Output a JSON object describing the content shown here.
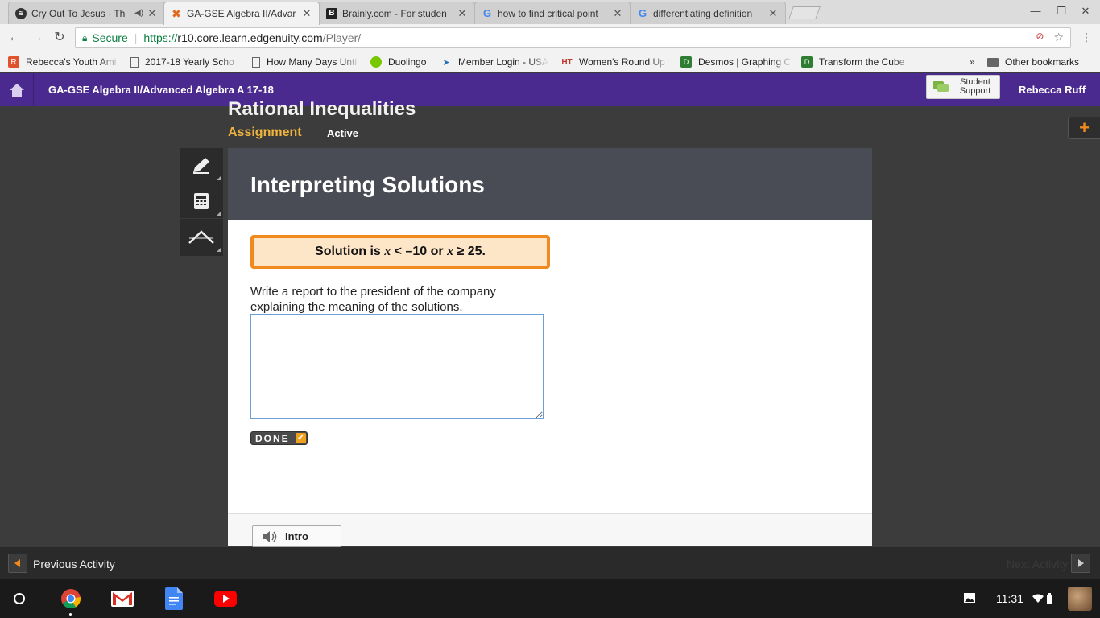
{
  "browser": {
    "tabs": [
      {
        "title": "Cry Out To Jesus · Th",
        "favicon": "spotify-icon",
        "audio": true,
        "active": false
      },
      {
        "title": "GA-GSE Algebra II/Advar",
        "favicon": "edgenuity-icon",
        "audio": false,
        "active": true
      },
      {
        "title": "Brainly.com - For studen",
        "favicon": "brainly-icon",
        "audio": false,
        "active": false
      },
      {
        "title": "how to find critical point",
        "favicon": "google-icon",
        "audio": false,
        "active": false
      },
      {
        "title": "differentiating definition",
        "favicon": "google-icon",
        "audio": false,
        "active": false
      }
    ],
    "omnibox": {
      "secure_label": "Secure",
      "url_scheme": "https://",
      "url_host": "r10.core.learn.edgenuity.com",
      "url_path": "/Player/"
    },
    "bookmarks": [
      {
        "label": "Rebecca's Youth Ami",
        "icon": "rebecca-icon"
      },
      {
        "label": "2017-18 Yearly Scho",
        "icon": "page-icon"
      },
      {
        "label": "How Many Days Unti",
        "icon": "page-icon"
      },
      {
        "label": "Duolingo",
        "icon": "duolingo-icon"
      },
      {
        "label": "Member Login - USAT",
        "icon": "cursor-icon"
      },
      {
        "label": "Women's Round Up S",
        "icon": "hr-icon"
      },
      {
        "label": "Desmos | Graphing C",
        "icon": "desmos-icon"
      },
      {
        "label": "Transform the Cube",
        "icon": "desmos-icon"
      }
    ],
    "overflow_label": "»",
    "other_bookmarks_label": "Other bookmarks"
  },
  "header": {
    "course_title": "GA-GSE Algebra II/Advanced Algebra A 17-18",
    "support_label_line1": "Student",
    "support_label_line2": "Support",
    "user_name": "Rebecca Ruff",
    "accent_color": "#4b2a8f"
  },
  "lesson": {
    "title": "Rational Inequalities",
    "type_label": "Assignment",
    "status_label": "Active"
  },
  "activity": {
    "title": "Interpreting Solutions",
    "solution_prefix": "Solution is ",
    "var1": "x",
    "ineq1": " < –10 or ",
    "var2": "x",
    "ineq2": " ≥ 25.",
    "prompt": "Write a report to the president of the company explaining the meaning of the solutions.",
    "response_value": "",
    "done_label": "DONE",
    "intro_label": "Intro"
  },
  "nav": {
    "prev_label": "Previous Activity",
    "next_label": "Next Activity"
  },
  "shelf": {
    "apps": [
      "chrome-icon",
      "gmail-icon",
      "docs-icon",
      "youtube-icon"
    ],
    "clock": "11:31"
  }
}
